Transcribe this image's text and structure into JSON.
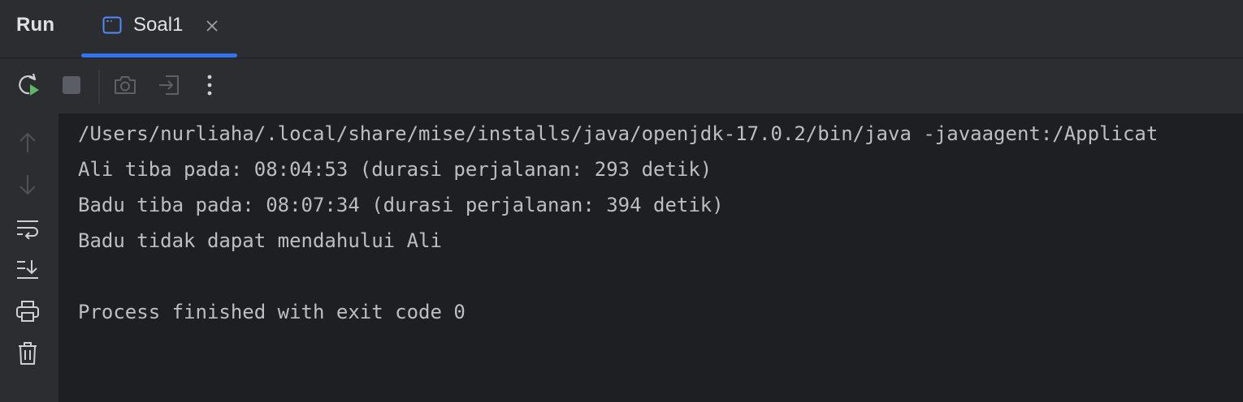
{
  "header": {
    "run_title": "Run",
    "tab": {
      "label": "Soal1",
      "icon": "console-window-icon",
      "close_icon": "close-icon"
    }
  },
  "toolbar": {
    "buttons": [
      {
        "name": "rerun-button",
        "icon": "rerun-icon"
      },
      {
        "name": "stop-button",
        "icon": "stop-icon"
      },
      {
        "name": "screenshot-button",
        "icon": "camera-icon"
      },
      {
        "name": "restore-layout-button",
        "icon": "exit-icon"
      },
      {
        "name": "more-options-button",
        "icon": "more-vertical-icon"
      }
    ]
  },
  "gutter": {
    "buttons": [
      {
        "name": "up-arrow-button",
        "icon": "arrow-up-icon"
      },
      {
        "name": "down-arrow-button",
        "icon": "arrow-down-icon"
      },
      {
        "name": "soft-wrap-button",
        "icon": "soft-wrap-icon"
      },
      {
        "name": "scroll-to-end-button",
        "icon": "scroll-to-end-icon"
      },
      {
        "name": "print-button",
        "icon": "printer-icon"
      },
      {
        "name": "clear-all-button",
        "icon": "trash-icon"
      }
    ]
  },
  "console": {
    "lines": [
      "/Users/nurliaha/.local/share/mise/installs/java/openjdk-17.0.2/bin/java -javaagent:/Applicat",
      "Ali tiba pada: 08:04:53 (durasi perjalanan: 293 detik)",
      "Badu tiba pada: 08:07:34 (durasi perjalanan: 394 detik)",
      "Badu tidak dapat mendahului Ali",
      "",
      "Process finished with exit code 0"
    ]
  },
  "colors": {
    "accent": "#3574f0",
    "run_green": "#5fb865",
    "text": "#bcbec4",
    "panel_bg": "#2b2d30",
    "console_bg": "#1e1f22"
  }
}
